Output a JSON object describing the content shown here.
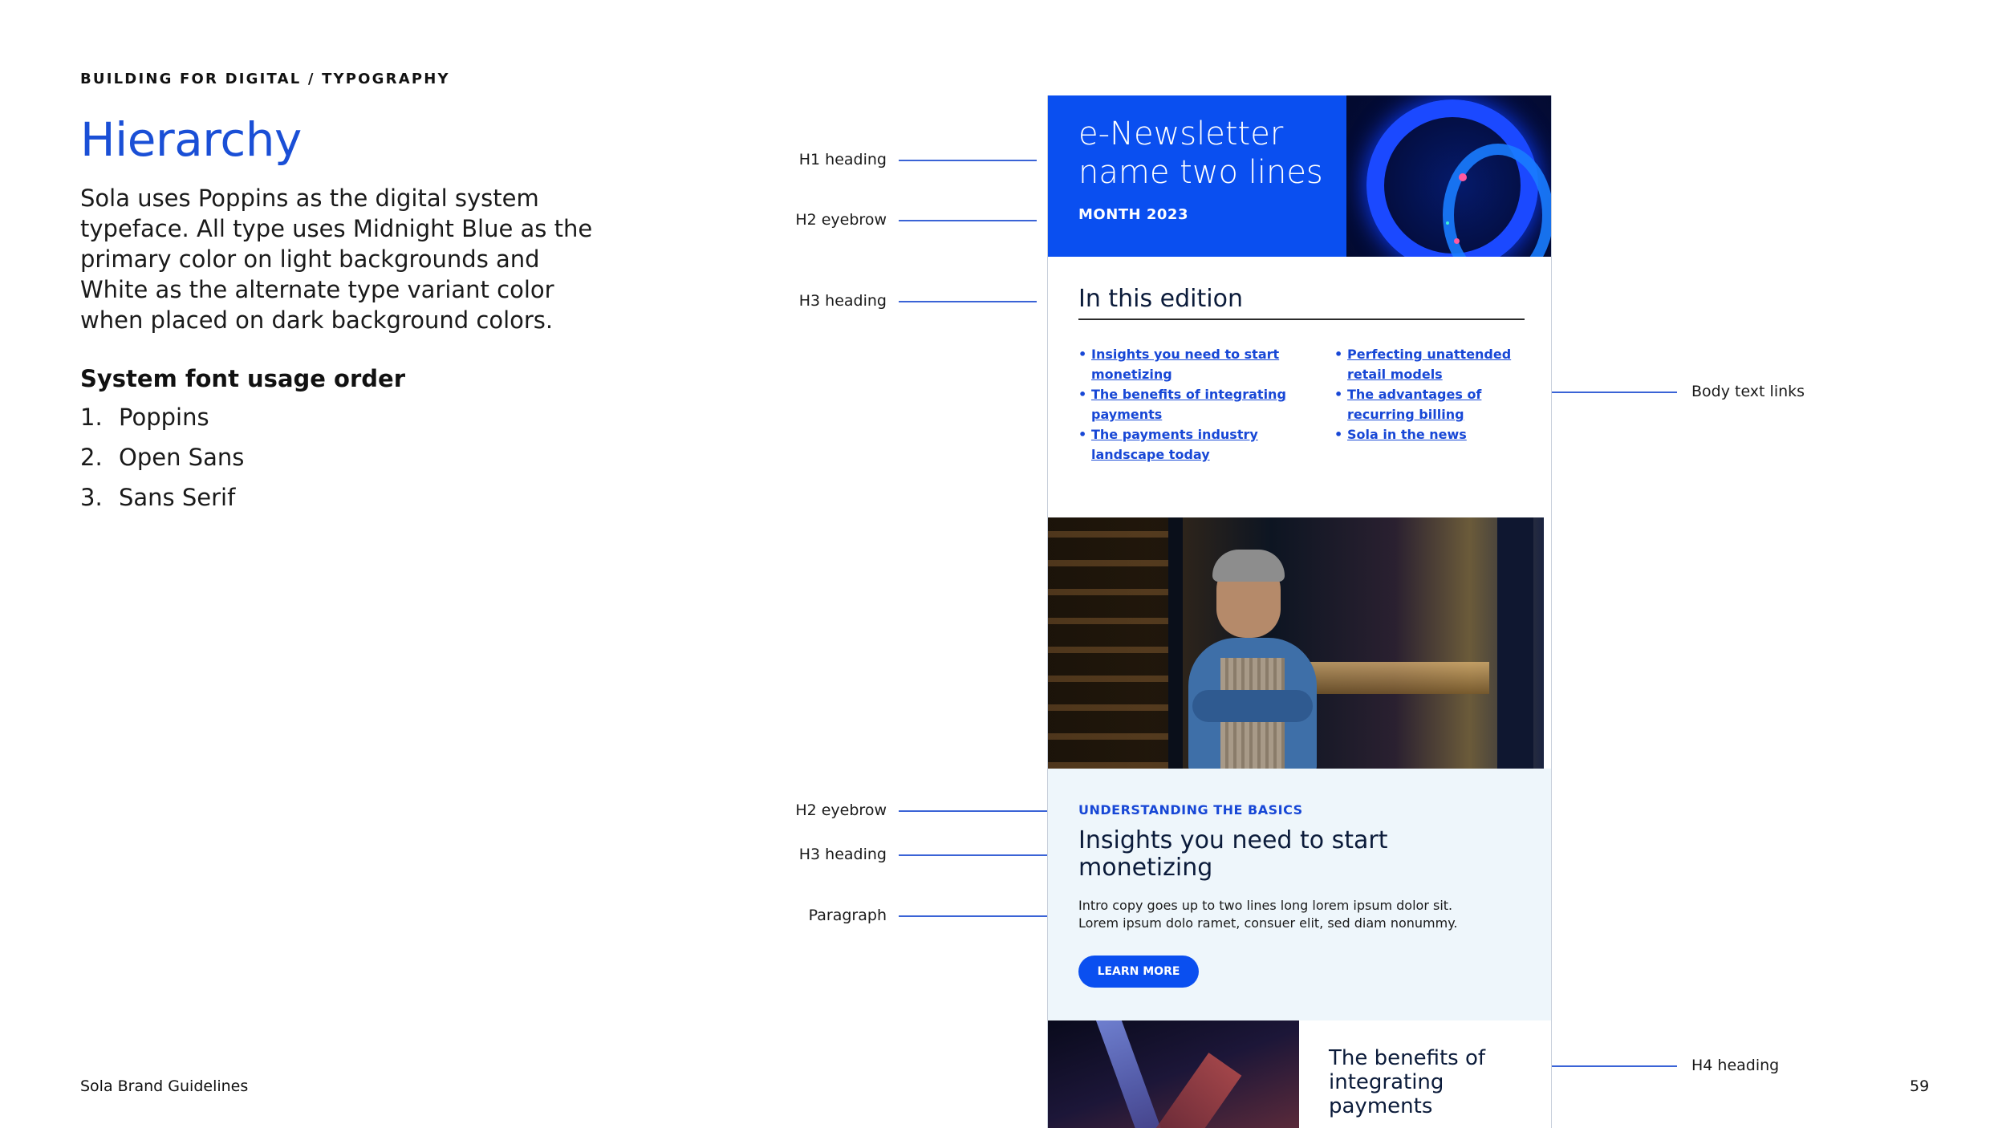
{
  "header": {
    "breadcrumb": "BUILDING FOR DIGITAL / TYPOGRAPHY"
  },
  "left": {
    "title": "Hierarchy",
    "intro": "Sola uses Poppins as the digital system typeface. All type uses Midnight Blue as the primary color on light backgrounds and White as the alternate type variant color when placed on dark background colors.",
    "font_usage_heading": "System font usage order",
    "font_usage": [
      {
        "num": "1.",
        "name": "Poppins"
      },
      {
        "num": "2.",
        "name": "Open Sans"
      },
      {
        "num": "3.",
        "name": "Sans Serif"
      }
    ]
  },
  "annotations": {
    "h1": "H1 heading",
    "h2_top": "H2 eyebrow",
    "h3_top": "H3 heading",
    "body_links": "Body text links",
    "h2_mid": "H2 eyebrow",
    "h3_mid": "H3 heading",
    "paragraph": "Paragraph",
    "h4": "H4 heading"
  },
  "newsletter": {
    "title": "e-Newsletter name two lines",
    "month": "MONTH 2023",
    "edition_title": "In this edition",
    "links_left": [
      "Insights you need to start monetizing",
      "The benefits of integrating payments",
      "The payments industry landscape today"
    ],
    "links_right": [
      "Perfecting unattended retail models",
      "The advantages of recurring billing",
      "Sola in the news"
    ],
    "section": {
      "eyebrow": "UNDERSTANDING THE BASICS",
      "heading": "Insights you need to start monetizing",
      "paragraph": "Intro copy goes up to two lines long lorem ipsum dolor sit. Lorem ipsum dolo ramet, consuer elit, sed diam nonummy.",
      "button": "LEARN MORE"
    },
    "h4": "The benefits of integrating payments"
  },
  "footer": {
    "brand": "Sola Brand Guidelines",
    "page": "59"
  },
  "colors": {
    "accent": "#1a4fd6",
    "brand_blue": "#0a4ff0",
    "midnight": "#0b1b3a",
    "section_bg": "#eef6fb"
  }
}
